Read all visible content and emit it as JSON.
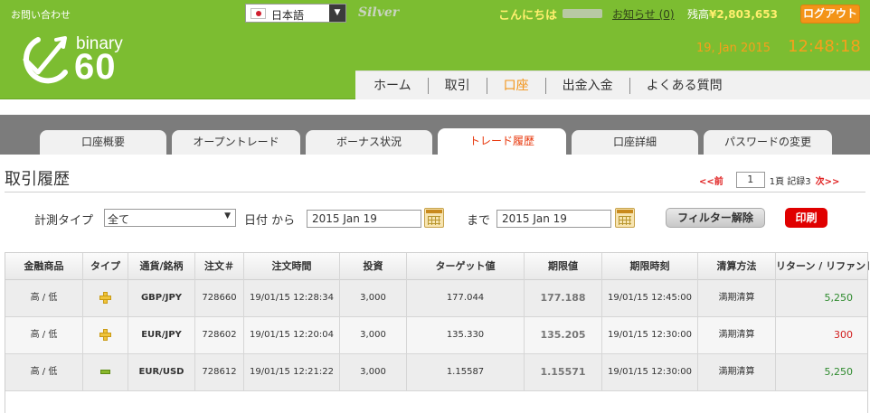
{
  "header": {
    "contact_label": "お問い合わせ",
    "language": "日本語",
    "tier": "Silver",
    "greeting": "こんにちは",
    "notice_label": "お知らせ (0)",
    "balance_label": "残高",
    "balance_value": "¥2,803,653",
    "logout_label": "ログアウト",
    "date": "19, Jan 2015",
    "time": "12:48:18",
    "logo_top": "binary",
    "logo_bottom": "60",
    "colors": {
      "header_bg": "#7cbd31",
      "accent": "#f39418",
      "highlight": "#ffef6e"
    }
  },
  "mainnav": {
    "items": [
      {
        "label": "ホーム",
        "active": false
      },
      {
        "label": "取引",
        "active": false
      },
      {
        "label": "口座",
        "active": true
      },
      {
        "label": "出金入金",
        "active": false
      },
      {
        "label": "よくある質問",
        "active": false
      }
    ]
  },
  "tabs": [
    {
      "label": "口座概要",
      "active": false
    },
    {
      "label": "オープントレード",
      "active": false
    },
    {
      "label": "ボーナス状況",
      "active": false
    },
    {
      "label": "トレード履歴",
      "active": true
    },
    {
      "label": "口座詳細",
      "active": false
    },
    {
      "label": "パスワードの変更",
      "active": false
    }
  ],
  "page": {
    "title": "取引履歴",
    "pager": {
      "prev": "<<前",
      "page": "1",
      "info": "1頁 記録3",
      "next": "次>>"
    }
  },
  "filter": {
    "type_label": "計測タイプ",
    "type_value": "全て",
    "date_label": "日付 から",
    "from_value": "2015 Jan 19",
    "to_label": "まで",
    "to_value": "2015 Jan 19",
    "clear_label": "フィルター解除",
    "print_label": "印刷"
  },
  "table": {
    "headers": [
      "金融商品",
      "タイプ",
      "通貨/銘柄",
      "注文＃",
      "注文時間",
      "投資",
      "ターゲット値",
      "期限値",
      "期限時刻",
      "清算方法",
      "リターン / リファンド"
    ],
    "rows": [
      {
        "product": "高 / 低",
        "type": "up",
        "pair": "GBP/JPY",
        "order": "728660",
        "order_time": "19/01/15 12:28:34",
        "investment": "3,000",
        "target": "177.044",
        "expiry_value": "177.188",
        "expiry_time": "19/01/15 12:45:00",
        "settlement": "満期清算",
        "return": "5,250",
        "result": "win"
      },
      {
        "product": "高 / 低",
        "type": "up",
        "pair": "EUR/JPY",
        "order": "728602",
        "order_time": "19/01/15 12:20:04",
        "investment": "3,000",
        "target": "135.330",
        "expiry_value": "135.205",
        "expiry_time": "19/01/15 12:30:00",
        "settlement": "満期清算",
        "return": "300",
        "result": "loss"
      },
      {
        "product": "高 / 低",
        "type": "down",
        "pair": "EUR/USD",
        "order": "728612",
        "order_time": "19/01/15 12:21:22",
        "investment": "3,000",
        "target": "1.15587",
        "expiry_value": "1.15571",
        "expiry_time": "19/01/15 12:30:00",
        "settlement": "満期清算",
        "return": "5,250",
        "result": "win"
      }
    ]
  }
}
